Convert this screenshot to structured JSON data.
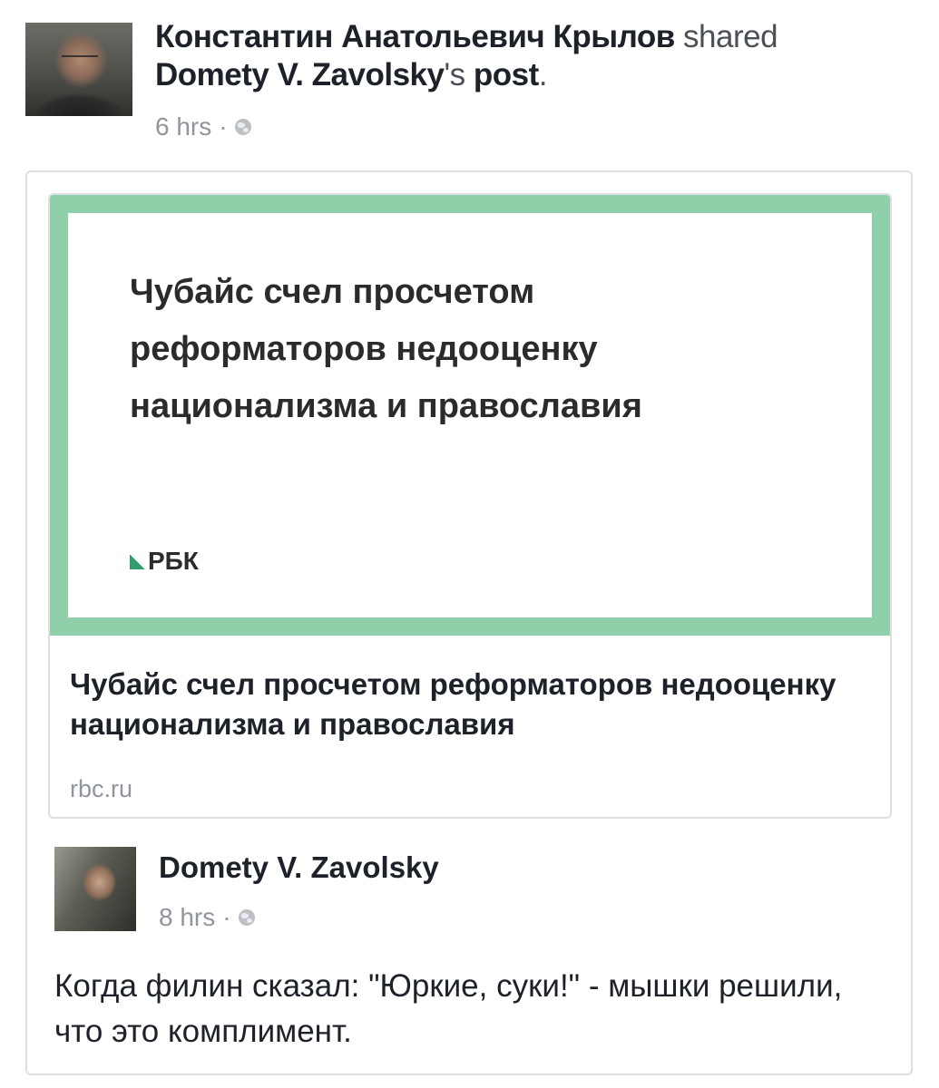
{
  "header": {
    "sharer_name": "Константин Анатольевич Крылов",
    "shared_word": "shared",
    "original_author": "Domety V. Zavolsky",
    "possessive": "'s",
    "post_word": "post",
    "period": ".",
    "time": "6 hrs",
    "separator": "·",
    "privacy_icon": "globe-icon"
  },
  "link_card": {
    "thumbnail_title": "Чубайс счел просчетом\nреформаторов недооценку\nнационализма и православия",
    "thumbnail_brand": "РБК",
    "title": "Чубайс счел просчетом реформаторов недооценку национализма и православия",
    "domain": "rbc.ru",
    "accent_color": "#8fcfa9"
  },
  "shared_post": {
    "author": "Domety V. Zavolsky",
    "time": "8 hrs",
    "separator": "·",
    "privacy_icon": "globe-icon",
    "text": "Когда филин сказал: \"Юркие, суки!\" - мышки решили, что это комплимент."
  }
}
